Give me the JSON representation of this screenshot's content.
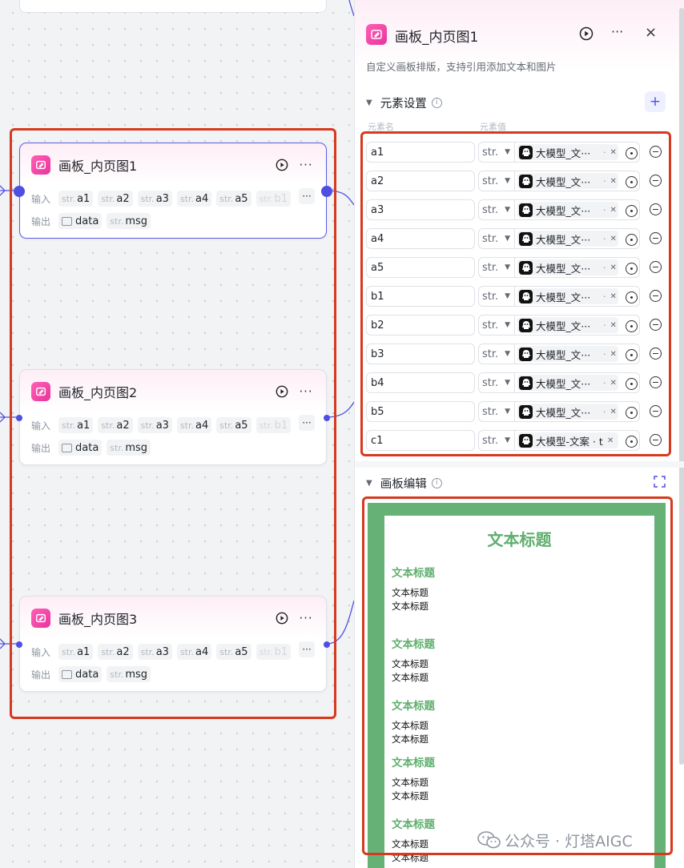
{
  "nodes": [
    {
      "title": "画板_内页图1",
      "input_label": "输入",
      "output_label": "输出",
      "inputs": [
        {
          "type": "str.",
          "name": "a1"
        },
        {
          "type": "str.",
          "name": "a2"
        },
        {
          "type": "str.",
          "name": "a3"
        },
        {
          "type": "str.",
          "name": "a4"
        },
        {
          "type": "str.",
          "name": "a5"
        },
        {
          "type": "str.",
          "name": "b1"
        }
      ],
      "more": "···",
      "outputs": [
        {
          "type": "img",
          "name": "data"
        },
        {
          "type": "str.",
          "name": "msg"
        }
      ]
    },
    {
      "title": "画板_内页图2",
      "input_label": "输入",
      "output_label": "输出",
      "inputs": [
        {
          "type": "str.",
          "name": "a1"
        },
        {
          "type": "str.",
          "name": "a2"
        },
        {
          "type": "str.",
          "name": "a3"
        },
        {
          "type": "str.",
          "name": "a4"
        },
        {
          "type": "str.",
          "name": "a5"
        },
        {
          "type": "str.",
          "name": "b1"
        }
      ],
      "more": "···",
      "outputs": [
        {
          "type": "img",
          "name": "data"
        },
        {
          "type": "str.",
          "name": "msg"
        }
      ]
    },
    {
      "title": "画板_内页图3",
      "input_label": "输入",
      "output_label": "输出",
      "inputs": [
        {
          "type": "str.",
          "name": "a1"
        },
        {
          "type": "str.",
          "name": "a2"
        },
        {
          "type": "str.",
          "name": "a3"
        },
        {
          "type": "str.",
          "name": "a4"
        },
        {
          "type": "str.",
          "name": "a5"
        },
        {
          "type": "str.",
          "name": "b1"
        }
      ],
      "more": "···",
      "outputs": [
        {
          "type": "img",
          "name": "data"
        },
        {
          "type": "str.",
          "name": "msg"
        }
      ]
    }
  ],
  "panel": {
    "title": "画板_内页图1",
    "more": "···",
    "close": "×",
    "description": "自定义画板排版，支持引用添加文本和图片",
    "elements_section": {
      "title": "元素设置",
      "add": "+",
      "col_name": "元素名",
      "col_value": "元素值",
      "rows": [
        {
          "name": "a1",
          "type": "str.",
          "ref": "大模型_文···",
          "sep": "·"
        },
        {
          "name": "a2",
          "type": "str.",
          "ref": "大模型_文···",
          "sep": "·"
        },
        {
          "name": "a3",
          "type": "str.",
          "ref": "大模型_文···",
          "sep": "·"
        },
        {
          "name": "a4",
          "type": "str.",
          "ref": "大模型_文···",
          "sep": "·"
        },
        {
          "name": "a5",
          "type": "str.",
          "ref": "大模型_文···",
          "sep": "·"
        },
        {
          "name": "b1",
          "type": "str.",
          "ref": "大模型_文···",
          "sep": "·"
        },
        {
          "name": "b2",
          "type": "str.",
          "ref": "大模型_文···",
          "sep": "·"
        },
        {
          "name": "b3",
          "type": "str.",
          "ref": "大模型_文···",
          "sep": "·"
        },
        {
          "name": "b4",
          "type": "str.",
          "ref": "大模型_文···",
          "sep": "·"
        },
        {
          "name": "b5",
          "type": "str.",
          "ref": "大模型_文···",
          "sep": "·"
        },
        {
          "name": "c1",
          "type": "str.",
          "ref": "大模型-文案 · t·",
          "sep": ""
        }
      ]
    },
    "canvas_section": {
      "title": "画板编辑",
      "main_title": "文本标题",
      "blocks": [
        {
          "heading": "文本标题",
          "lines": [
            "文本标题",
            "文本标题"
          ]
        },
        {
          "heading": "文本标题",
          "lines": [
            "文本标题",
            "文本标题"
          ]
        },
        {
          "heading": "文本标题",
          "lines": [
            "文本标题",
            "文本标题"
          ]
        },
        {
          "heading": "文本标题",
          "lines": [
            "文本标题",
            "文本标题"
          ]
        },
        {
          "heading": "文本标题",
          "lines": [
            "文本标题",
            "文本标题"
          ]
        }
      ]
    }
  },
  "watermark": "公众号 · 灯塔AIGC",
  "colors": {
    "accent": "#4e4fe0",
    "highlight_border": "#d63a1e",
    "canvas_green": "#66b176",
    "title_green": "#5fae6e"
  }
}
